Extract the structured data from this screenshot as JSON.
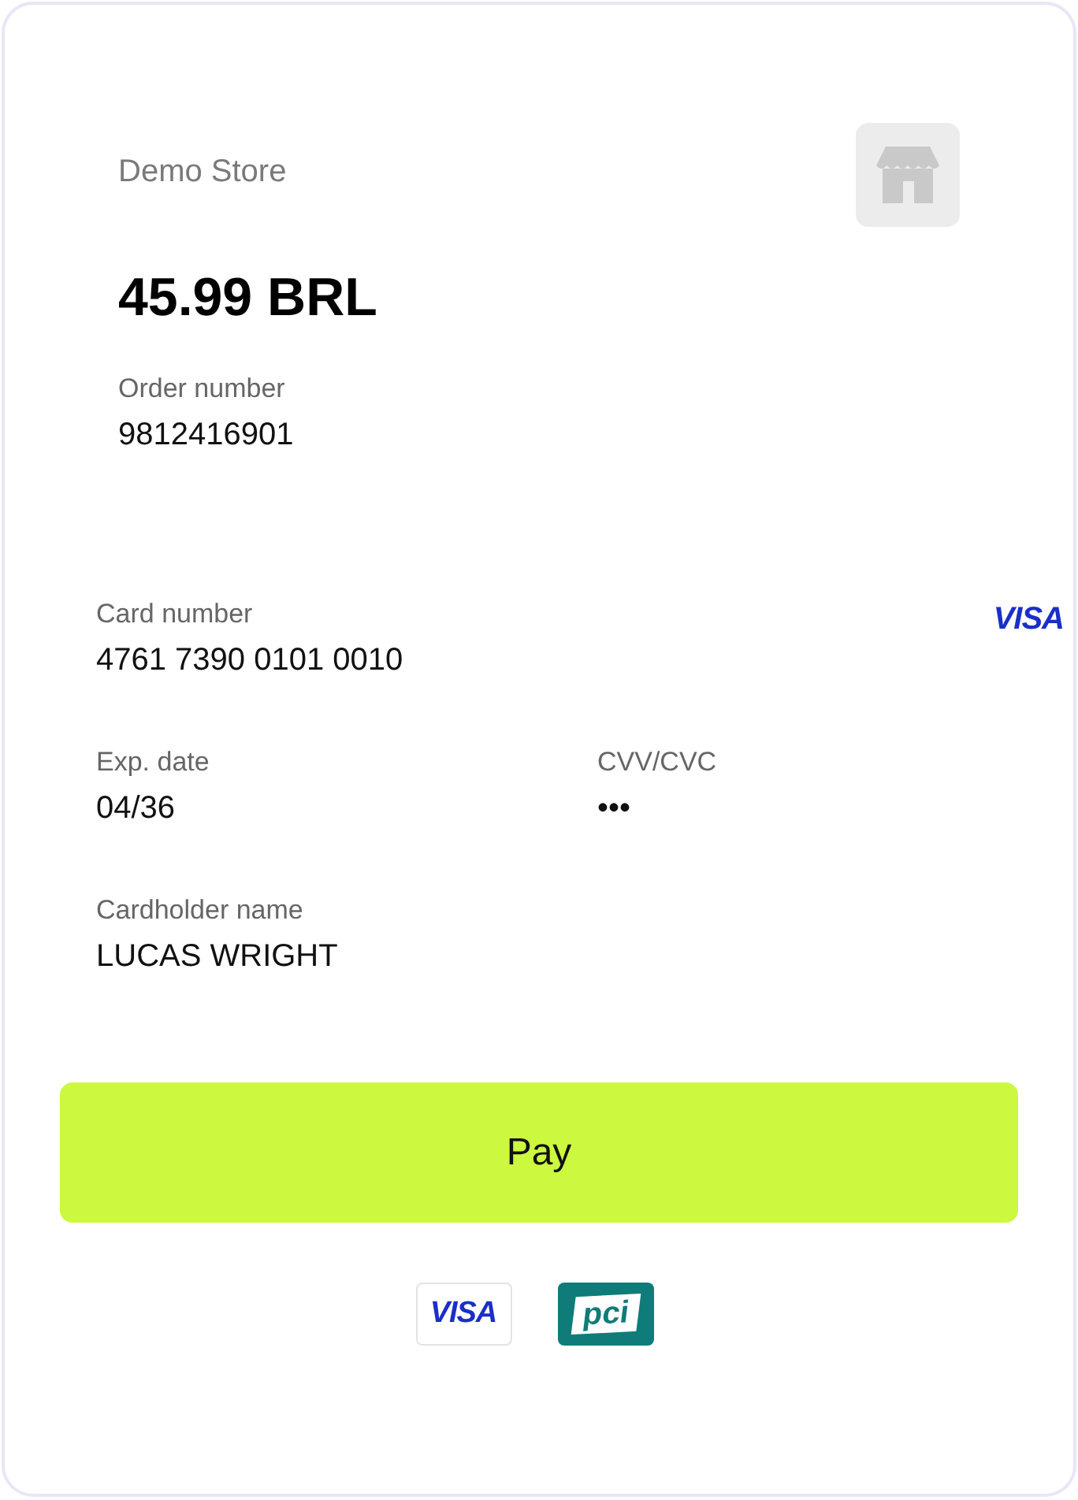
{
  "merchant": {
    "name": "Demo Store",
    "amount": "45.99 BRL",
    "order_label": "Order number",
    "order_number": "9812416901"
  },
  "card_brand": "VISA",
  "fields": [
    {
      "label": "Card number",
      "value": "4761 7390 0101 0010",
      "kind": "full"
    },
    {
      "label": "Exp. date",
      "value": "04/36",
      "kind": "half"
    },
    {
      "label": "CVV/CVC",
      "value": "•••",
      "kind": "half"
    },
    {
      "label": "Cardholder name",
      "value": "LUCAS WRIGHT",
      "kind": "full"
    }
  ],
  "pay_button": "Pay",
  "badges": [
    {
      "kind": "visa",
      "text": "VISA"
    },
    {
      "kind": "pci",
      "text": "pci"
    }
  ]
}
